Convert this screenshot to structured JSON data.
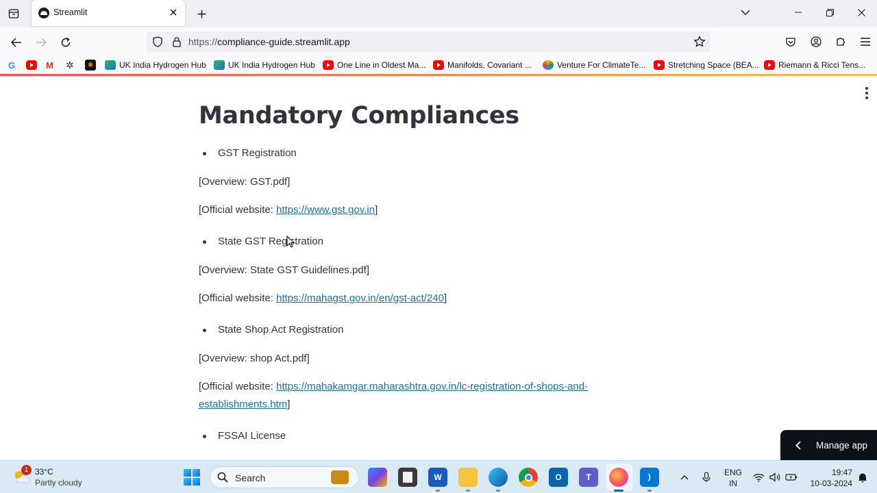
{
  "browser": {
    "tab_title": "Streamlit",
    "url_prefix": "https://",
    "url_host": "compliance-guide.streamlit.app"
  },
  "bookmarks": [
    {
      "label": "",
      "icon": "google-icon"
    },
    {
      "label": "",
      "icon": "youtube-icon"
    },
    {
      "label": "",
      "icon": "gmail-icon"
    },
    {
      "label": "",
      "icon": "gear-icon"
    },
    {
      "label": "",
      "icon": "app-icon"
    },
    {
      "label": "UK India Hydrogen Hub",
      "icon": "hub-icon"
    },
    {
      "label": "UK India Hydrogen Hub",
      "icon": "hub-icon"
    },
    {
      "label": "One Line in Oldest Ma...",
      "icon": "youtube-icon"
    },
    {
      "label": "Manifolds, Covariant ...",
      "icon": "youtube-icon"
    },
    {
      "label": "Venture For ClimateTe...",
      "icon": "venture-icon"
    },
    {
      "label": "Stretching Space (BEA...",
      "icon": "youtube-icon"
    },
    {
      "label": "Riemann & Ricci Tens...",
      "icon": "youtube-icon"
    }
  ],
  "page": {
    "title": "Mandatory Compliances",
    "sections": [
      {
        "item": "GST Registration",
        "overview": "[Overview: GST.pdf]",
        "website_prefix": "[Official website: ",
        "website_link": "https://www.gst.gov.in",
        "website_suffix": "]"
      },
      {
        "item": "State GST Registration",
        "overview": "[Overview: State GST Guidelines.pdf]",
        "website_prefix": "[Official website: ",
        "website_link": "https://mahagst.gov.in/en/gst-act/240",
        "website_suffix": "]"
      },
      {
        "item": "State Shop Act Registration",
        "overview": "[Overview: shop Act.pdf]",
        "website_prefix": "[Official website: ",
        "website_link": "https://mahakamgar.maharashtra.gov.in/lc-registration-of-shops-and-establishments.htm",
        "website_suffix": "]"
      },
      {
        "item": "FSSAI License"
      }
    ],
    "manage_app_label": "Manage app"
  },
  "taskbar": {
    "weather_badge": "1",
    "weather_temp": "33°C",
    "weather_condition": "Partly cloudy",
    "search_label": "Search",
    "language_top": "ENG",
    "language_bottom": "IN",
    "time": "19:47",
    "date": "10-03-2024"
  },
  "colors": {
    "link": "#1c6ea4",
    "text": "#31333f",
    "manage_app_bg": "#0e1117",
    "taskbar_bg": "#d9eaf5"
  }
}
